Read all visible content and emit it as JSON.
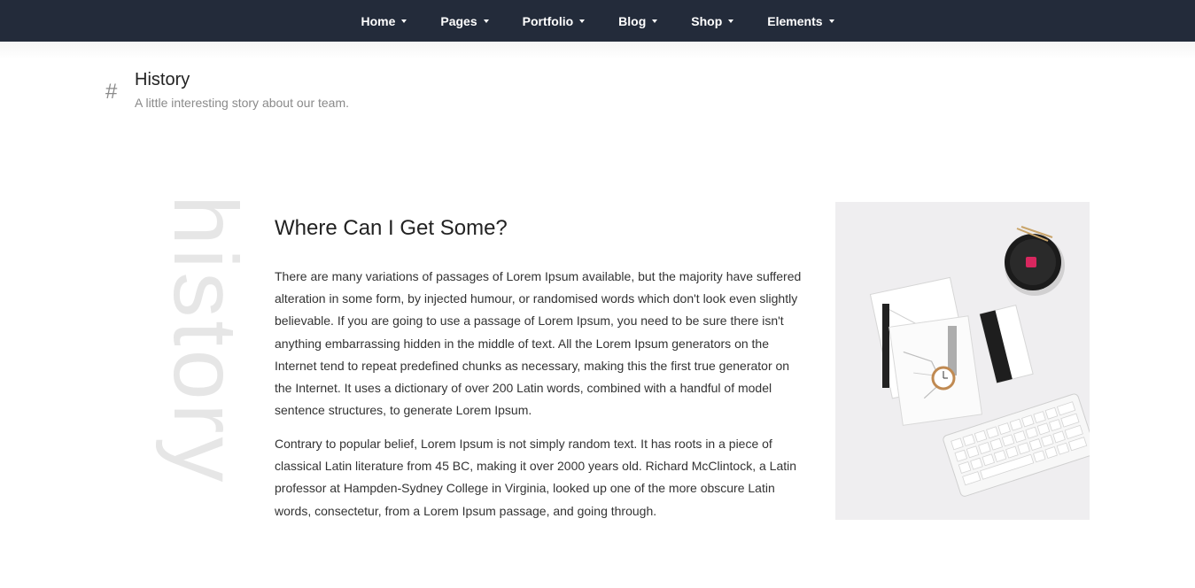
{
  "nav": {
    "items": [
      {
        "label": "Home"
      },
      {
        "label": "Pages"
      },
      {
        "label": "Portfolio"
      },
      {
        "label": "Blog"
      },
      {
        "label": "Shop"
      },
      {
        "label": "Elements"
      }
    ]
  },
  "section": {
    "hash": "#",
    "title": "History",
    "subtitle": "A little interesting story about our team."
  },
  "watermark": "history",
  "content": {
    "heading": "Where Can I Get Some?",
    "paragraphs": [
      "There are many variations of passages of Lorem Ipsum available, but the majority have suffered alteration in some form, by injected humour, or randomised words which don't look even slightly believable. If you are going to use a passage of Lorem Ipsum, you need to be sure there isn't anything embarrassing hidden in the middle of text. All the Lorem Ipsum generators on the Internet tend to repeat predefined chunks as necessary, making this the first true generator on the Internet. It uses a dictionary of over 200 Latin words, combined with a handful of model sentence structures, to generate Lorem Ipsum.",
      "Contrary to popular belief, Lorem Ipsum is not simply random text. It has roots in a piece of classical Latin literature from 45 BC, making it over 2000 years old. Richard McClintock, a Latin professor at Hampden-Sydney College in Virginia, looked up one of the more obscure Latin words, consectetur, from a Lorem Ipsum passage, and going through."
    ]
  },
  "colors": {
    "nav_bg": "#232b3a",
    "text": "#333333",
    "muted": "#8a8a8a",
    "watermark": "#e6e6e6"
  }
}
